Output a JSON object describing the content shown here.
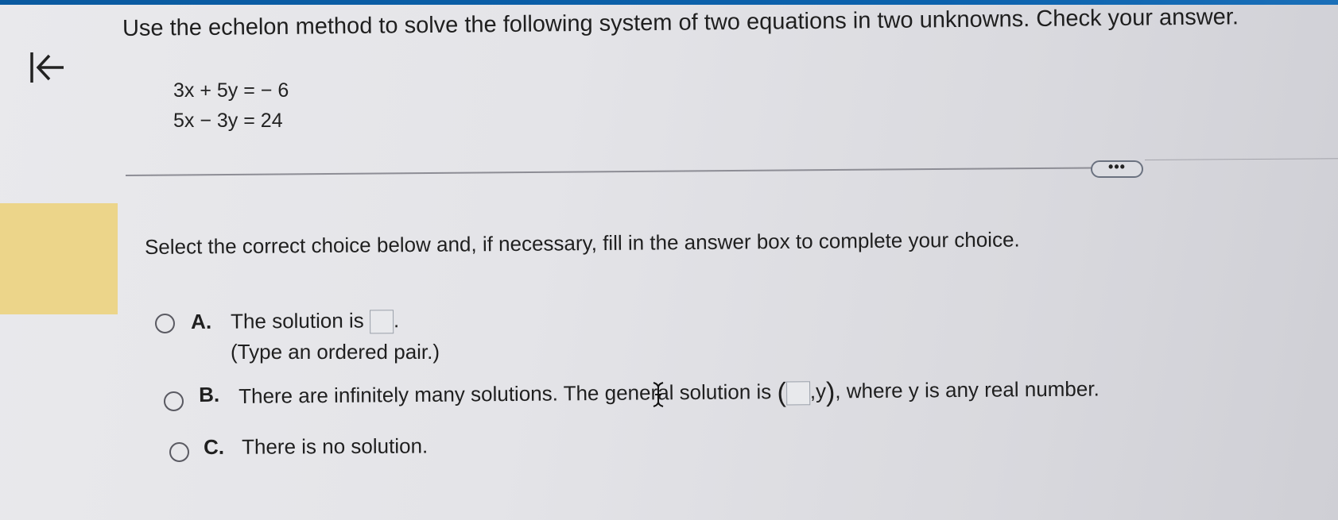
{
  "question": "Use the echelon method to solve the following system of two equations in two unknowns. Check your answer.",
  "equations": [
    "3x + 5y = − 6",
    "5x − 3y = 24"
  ],
  "more_button": "•••",
  "instruction": "Select the correct choice below and, if necessary, fill in the answer box to complete your choice.",
  "choices": {
    "a": {
      "letter": "A.",
      "text_before": "The solution is",
      "text_after": ".",
      "hint": "(Type an ordered pair.)"
    },
    "b": {
      "letter": "B.",
      "text_before": "There are infinitely many solutions. The general solution is",
      "paren_open": "(",
      "after_box": ",y",
      "paren_close": ")",
      "text_after": ", where y is any real number."
    },
    "c": {
      "letter": "C.",
      "text": "There is no solution."
    }
  },
  "colors": {
    "top_bar": "#0b62ad",
    "highlight": "#ecd58a"
  },
  "icons": {
    "back": "back-to-start-icon",
    "cursor": "text-cursor-icon"
  }
}
